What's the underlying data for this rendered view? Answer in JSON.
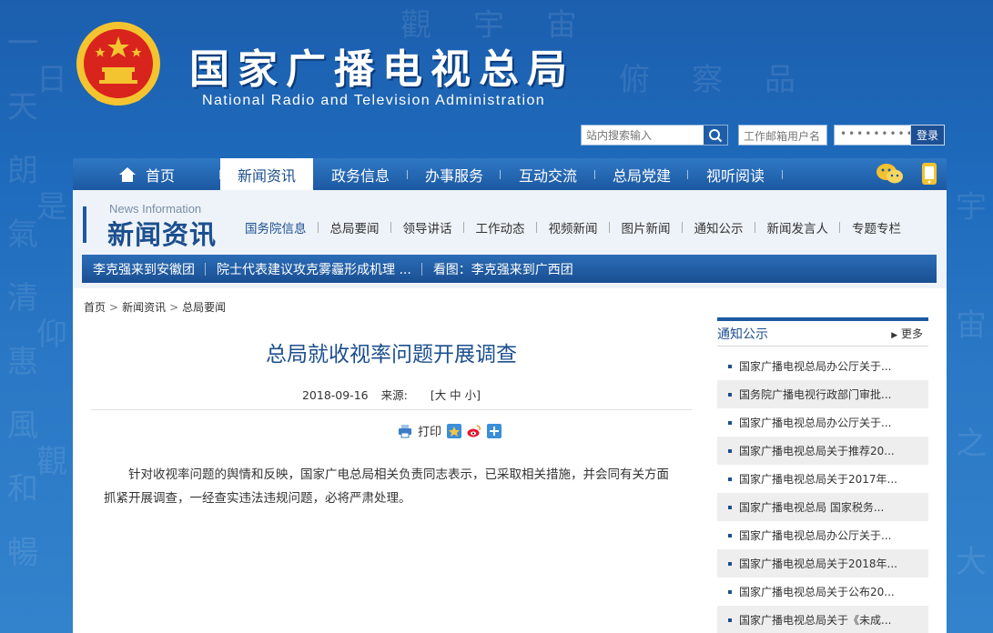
{
  "header": {
    "title_cn": "国家广播电视总局",
    "title_en": "National Radio and Television Administration",
    "search_placeholder": "站内搜索输入",
    "mail_user_placeholder": "工作邮箱用户名",
    "mail_pass_mask": "•••••••••",
    "login_label": "登录"
  },
  "nav": {
    "items": [
      {
        "label": "首页",
        "icon": "home-icon"
      },
      {
        "label": "新闻资讯"
      },
      {
        "label": "政务信息"
      },
      {
        "label": "办事服务"
      },
      {
        "label": "互动交流"
      },
      {
        "label": "总局党建"
      },
      {
        "label": "视听阅读"
      }
    ],
    "right_icons": [
      "wechat-icon",
      "mobile-icon"
    ]
  },
  "section": {
    "en": "News Information",
    "cn": "新闻资讯",
    "subnav": [
      "国务院信息",
      "总局要闻",
      "领导讲话",
      "工作动态",
      "视频新闻",
      "图片新闻",
      "通知公示",
      "新闻发言人",
      "专题专栏"
    ],
    "ticker": [
      "李克强来到安徽团",
      "院士代表建议攻克雾霾形成机理 ...",
      "看图：李克强来到广西团"
    ]
  },
  "breadcrumb": [
    "首页",
    "新闻资讯",
    "总局要闻"
  ],
  "article": {
    "title": "总局就收视率问题开展调查",
    "date": "2018-09-16",
    "source_label": "来源:",
    "font_size": "[大 中 小]",
    "print_label": "打印",
    "body": "针对收视率问题的舆情和反映，国家广电总局相关负责同志表示，已采取相关措施，并会同有关方面抓紧开展调查，一经查实违法违规问题，必将严肃处理。"
  },
  "notice": {
    "title": "通知公示",
    "more": "更多",
    "items": [
      "国家广播电视总局办公厅关于...",
      "国务院广播电视行政部门审批...",
      "国家广播电视总局办公厅关于...",
      "国家广播电视总局关于推荐20...",
      "国家广播电视总局关于2017年...",
      "国家广播电视总局 国家税务...",
      "国家广播电视总局办公厅关于...",
      "国家广播电视总局关于2018年...",
      "国家广播电视总局关于公布20...",
      "国家广播电视总局关于《未成..."
    ]
  },
  "colors": {
    "primary": "#1c59a2",
    "title_blue": "#1c4f8e",
    "emblem_red": "#d8241c",
    "emblem_gold": "#f4c430"
  }
}
